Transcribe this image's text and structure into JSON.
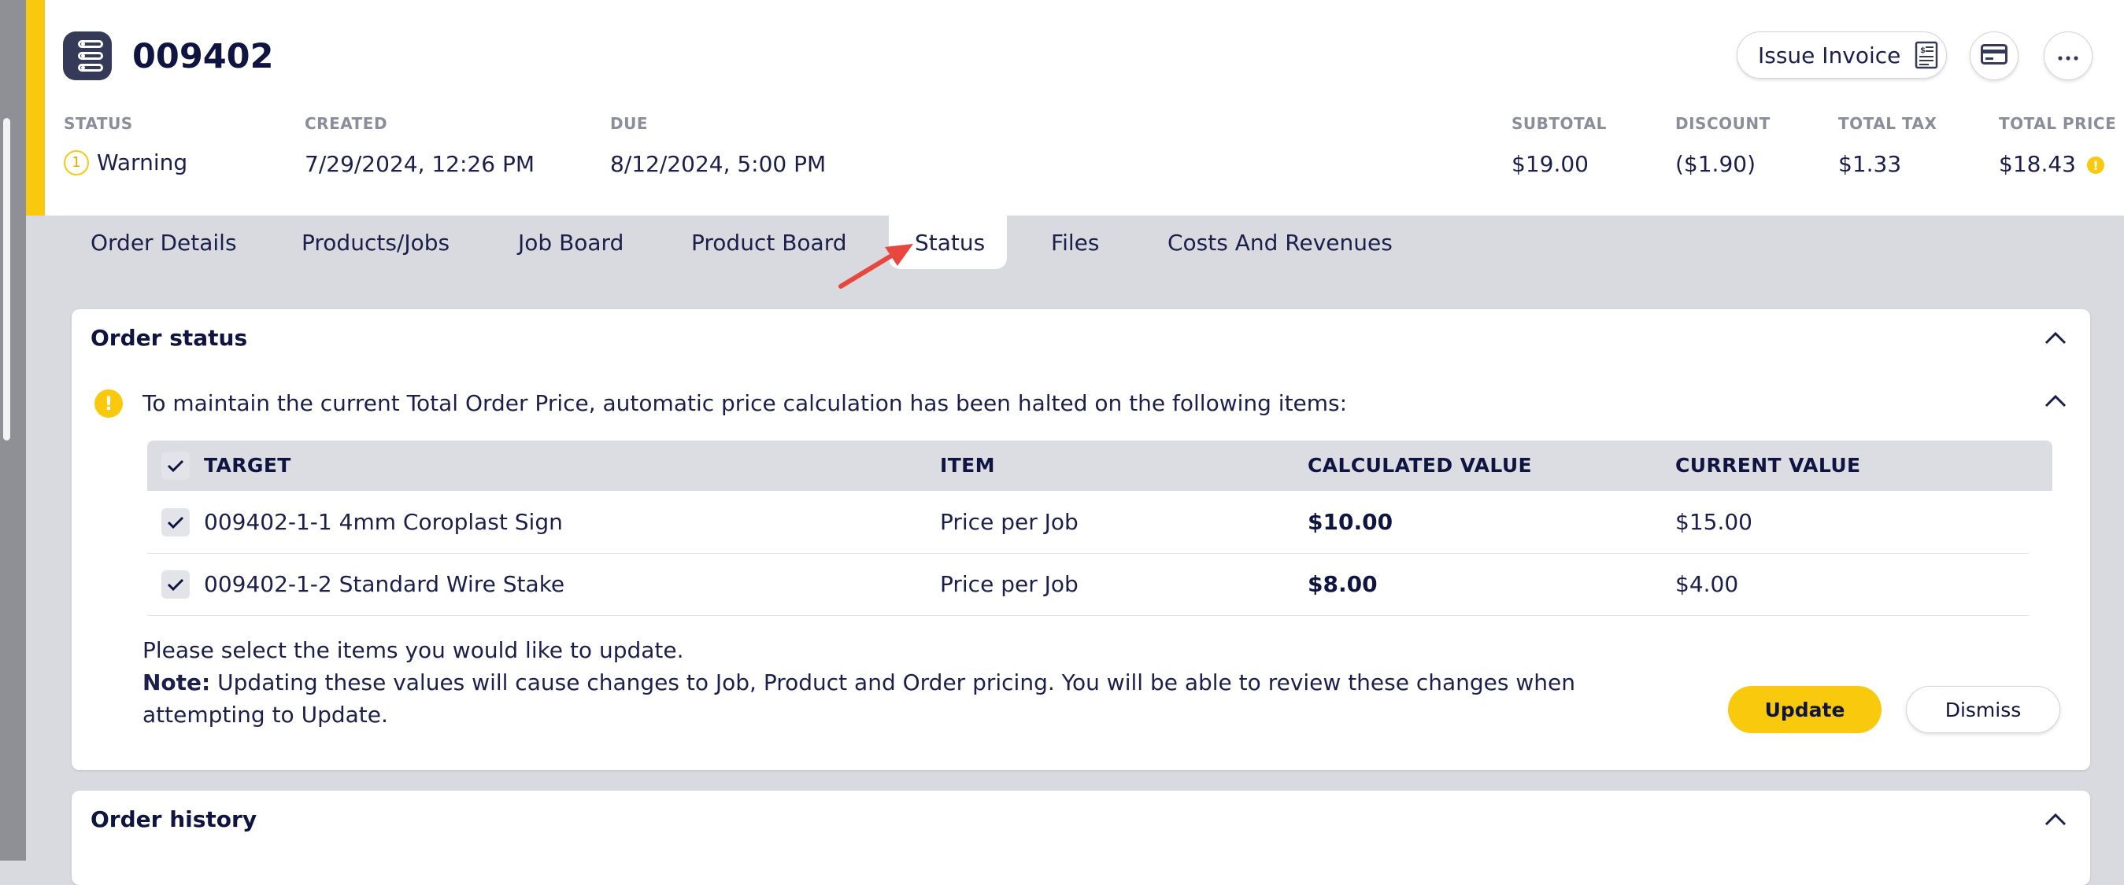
{
  "order": {
    "number": "009402"
  },
  "header_actions": {
    "issue_invoice_label": "Issue Invoice",
    "icons": [
      "invoice-icon",
      "credit-card-icon",
      "more-icon"
    ]
  },
  "summary": {
    "status": {
      "label": "STATUS",
      "count": "1",
      "value": "Warning"
    },
    "created": {
      "label": "CREATED",
      "value": "7/29/2024, 12:26 PM"
    },
    "due": {
      "label": "DUE",
      "value": "8/12/2024, 5:00 PM"
    },
    "subtotal": {
      "label": "SUBTOTAL",
      "value": "$19.00"
    },
    "discount": {
      "label": "DISCOUNT",
      "value": "($1.90)"
    },
    "total_tax": {
      "label": "TOTAL TAX",
      "value": "$1.33"
    },
    "total_price": {
      "label": "TOTAL PRICE",
      "value": "$18.43"
    }
  },
  "tabs": [
    {
      "label": "Order Details"
    },
    {
      "label": "Products/Jobs"
    },
    {
      "label": "Job Board"
    },
    {
      "label": "Product Board"
    },
    {
      "label": "Status",
      "active": true
    },
    {
      "label": "Files"
    },
    {
      "label": "Costs And Revenues"
    }
  ],
  "order_status": {
    "title": "Order status",
    "alert_message": "To maintain the current Total Order Price, automatic price calculation has been halted on the following items:",
    "columns": [
      "TARGET",
      "ITEM",
      "CALCULATED VALUE",
      "CURRENT VALUE"
    ],
    "rows": [
      {
        "target": "009402-1-1 4mm Coroplast Sign",
        "item": "Price per Job",
        "calculated": "$10.00",
        "current": "$15.00",
        "checked": true
      },
      {
        "target": "009402-1-2 Standard Wire Stake",
        "item": "Price per Job",
        "calculated": "$8.00",
        "current": "$4.00",
        "checked": true
      }
    ],
    "instruction": "Please select the items you would like to update.",
    "note_label": "Note:",
    "note_text": " Updating these values will cause changes to Job, Product and Order pricing. You will be able to review these changes when attempting to Update.",
    "update_label": "Update",
    "dismiss_label": "Dismiss"
  },
  "order_history": {
    "title": "Order history"
  },
  "colors": {
    "accent": "#f8c90d",
    "text": "#1b1f4b",
    "background": "#d9dadf"
  }
}
